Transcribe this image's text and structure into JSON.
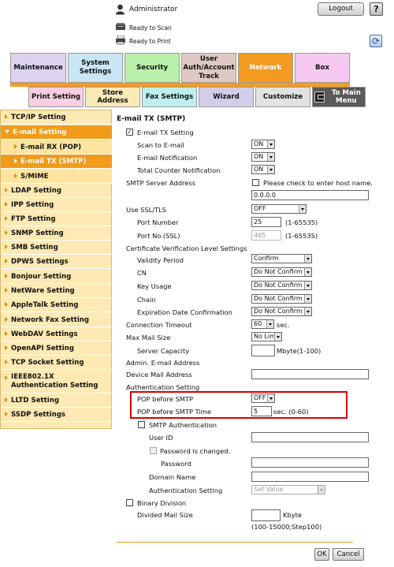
{
  "header": {
    "admin_label": "Administrator",
    "logout_label": "Logout",
    "help_label": "?",
    "status_scan": "Ready to Scan",
    "status_print": "Ready to Print"
  },
  "tabs_top": [
    {
      "label": "Maintenance",
      "color": "#ddd3f0"
    },
    {
      "label": "System Settings",
      "color": "#c8e6f5"
    },
    {
      "label": "Security",
      "color": "#b9f0a9"
    },
    {
      "label": "User Auth/Account Track",
      "color": "#e0c9c4"
    },
    {
      "label": "Network",
      "color": "#f49b22"
    },
    {
      "label": "Box",
      "color": "#f5c9f0"
    }
  ],
  "tabs_second": [
    {
      "label": "Print Setting",
      "color": "#f8cfe2"
    },
    {
      "label": "Store Address",
      "color": "#f9e9b7"
    },
    {
      "label": "Fax Settings",
      "color": "#bfeeee"
    },
    {
      "label": "Wizard",
      "color": "#d3cdea"
    },
    {
      "label": "Customize",
      "color": "#e2e2e2"
    },
    {
      "label": "To Main Menu",
      "color": "#595959"
    }
  ],
  "sidebar": [
    {
      "label": "TCP/IP Setting"
    },
    {
      "label": "E-mail Setting"
    },
    {
      "label": "E-mail RX (POP)"
    },
    {
      "label": "E-mail TX (SMTP)"
    },
    {
      "label": "S/MIME"
    },
    {
      "label": "LDAP Setting"
    },
    {
      "label": "IPP Setting"
    },
    {
      "label": "FTP Setting"
    },
    {
      "label": "SNMP Setting"
    },
    {
      "label": "SMB Setting"
    },
    {
      "label": "DPWS Settings"
    },
    {
      "label": "Bonjour Setting"
    },
    {
      "label": "NetWare Setting"
    },
    {
      "label": "AppleTalk Setting"
    },
    {
      "label": "Network Fax Setting"
    },
    {
      "label": "WebDAV Settings"
    },
    {
      "label": "OpenAPI Setting"
    },
    {
      "label": "TCP Socket Setting"
    },
    {
      "label": "IEEE802.1X Authentication Setting"
    },
    {
      "label": "LLTD Setting"
    },
    {
      "label": "SSDP Settings"
    }
  ],
  "form": {
    "title": "E-mail TX (SMTP)",
    "email_tx_setting": "E-mail TX Setting",
    "scan_to_email": {
      "label": "Scan to E-mail",
      "value": "ON"
    },
    "email_notification": {
      "label": "E-mail Notification",
      "value": "ON"
    },
    "total_counter_notification": {
      "label": "Total Counter Notification",
      "value": "ON"
    },
    "smtp_server_address": {
      "label": "SMTP Server Address",
      "hostname_check": "Please check to enter host name.",
      "value": "0.0.0.0"
    },
    "use_ssl_tls": {
      "label": "Use SSL/TLS",
      "value": "OFF"
    },
    "port_number": {
      "label": "Port Number",
      "value": "25",
      "range": "(1-65535)"
    },
    "port_no_ssl": {
      "label": "Port No.(SSL)",
      "value": "465",
      "range": "(1-65535)"
    },
    "cert_verification": "Certificate Verification Level Settings",
    "validity_period": {
      "label": "Validity Period",
      "value": "Confirm"
    },
    "cn": {
      "label": "CN",
      "value": "Do Not Confirm"
    },
    "key_usage": {
      "label": "Key Usage",
      "value": "Do Not Confirm"
    },
    "chain": {
      "label": "Chain",
      "value": "Do Not Confirm"
    },
    "expiration_date": {
      "label": "Expiration Date Confirmation",
      "value": "Do Not Confirm"
    },
    "connection_timeout": {
      "label": "Connection Timeout",
      "value": "60",
      "unit": "sec."
    },
    "max_mail_size": {
      "label": "Max Mail Size",
      "value": "No Limit"
    },
    "server_capacity": {
      "label": "Server Capacity",
      "value": "",
      "unit": "Mbyte(1-100)"
    },
    "admin_email": {
      "label": "Admin. E-mail Address"
    },
    "device_mail_address": {
      "label": "Device Mail Address",
      "value": ""
    },
    "auth_setting": "Authentication Setting",
    "pop_before_smtp": {
      "label": "POP before SMTP",
      "value": "OFF"
    },
    "pop_before_smtp_time": {
      "label": "POP before SMTP Time",
      "value": "5",
      "unit": "sec. (0-60)"
    },
    "smtp_authentication": "SMTP Authentication",
    "user_id": {
      "label": "User ID",
      "value": ""
    },
    "password_changed": "Password is changed.",
    "password": {
      "label": "Password",
      "value": ""
    },
    "domain_name": {
      "label": "Domain Name",
      "value": ""
    },
    "auth_setting_value": {
      "label": "Authentication Setting",
      "value": "Set Value"
    },
    "binary_division": "Binary Division",
    "divided_mail_size": {
      "label": "Divided Mail Size",
      "value": "",
      "unit": "Kbyte",
      "range": "(100-15000;Step100)"
    }
  },
  "buttons": {
    "ok": "OK",
    "cancel": "Cancel"
  }
}
